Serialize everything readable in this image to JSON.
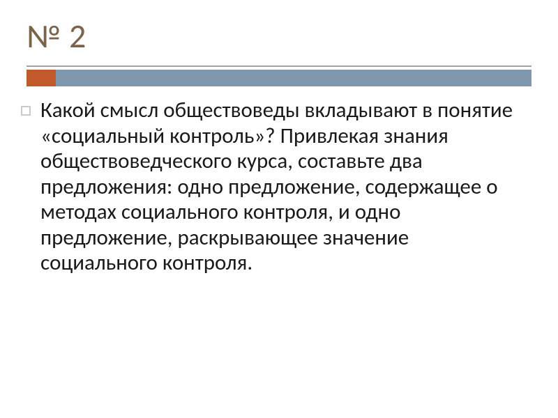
{
  "slide": {
    "title": "№ 2",
    "bullet": "Какой смысл обществоведы вкладывают в понятие «социальный контроль»? Привлекая знания обществоведческого курса, составьте два предложения: одно предложение, содержащее о методах социального контроля, и одно предложение, раскрывающее значение социального контроля."
  }
}
